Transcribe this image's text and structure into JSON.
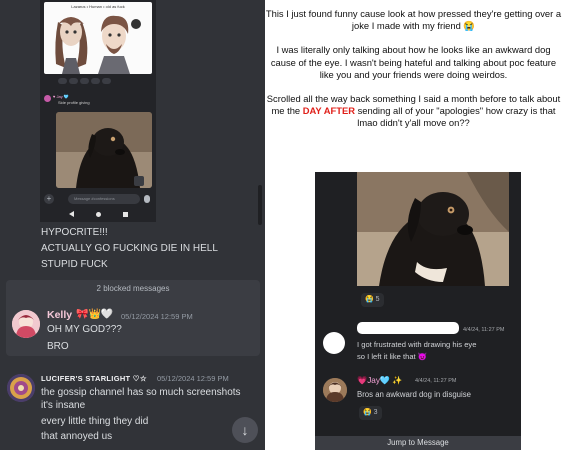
{
  "left": {
    "phone": {
      "drawing_caption": "Lazarus • Human • old as fuck",
      "mini_name": "♥ Jay 🩵 ",
      "mini_text": "Side profile giving",
      "input_placeholder": "Message #confessions",
      "plus_icon": "+"
    },
    "hypocrite_lines": [
      "HYPOCRITE!!!",
      "ACTUALLY GO FUCKING DIE IN HELL",
      "STUPID FUCK"
    ],
    "blocked_label": "2 blocked messages",
    "kelly": {
      "name": "Kelly",
      "emojis": "🎀👑🤍",
      "time": "05/12/2024 12:59 PM",
      "msg1": "OH MY GOD???",
      "msg2": "BRO"
    },
    "lucifer": {
      "name": "LUCIFER'S STARLIGHT ♡☆",
      "time": "05/12/2024 12:59 PM",
      "lines": [
        "the gossip channel has so much screenshots",
        "it's insane",
        "every little thing they did",
        "that annoyed us"
      ]
    },
    "jump_down_icon": "↓"
  },
  "caption": {
    "p1": "This I just found funny cause look at how pressed they're getting over a joke I made with my friend 😭",
    "p2": "I was literally only talking about how he looks like an awkward dog cause of the eye. I wasn't being hateful and talking about poc feature like you and your friends were doing weirdos.",
    "p3_before": "Scrolled all the way back something I said a month before to talk about me the ",
    "p3_red": "DAY AFTER",
    "p3_after": " sending all of your \"apologies\" how crazy is that lmao didn't y'all move on??"
  },
  "shot": {
    "reaction1": "😭 5",
    "anon_time": "4/4/24, 11:27 PM",
    "anon_lines": [
      "I got frustrated with drawing his eye",
      "so I left it like that 😈"
    ],
    "jay_name": "💗Jay🩵 ✨",
    "jay_time": "4/4/24, 11:27 PM",
    "jay_msg": "Bros an awkward dog in disguise",
    "reaction2": "😭 3",
    "jump_label": "Jump to Message"
  },
  "colors": {
    "discord_bg": "#313338",
    "accent_red": "#e0201a",
    "kelly_name": "#f3c7d8",
    "jay_name": "#f2a2d5"
  }
}
